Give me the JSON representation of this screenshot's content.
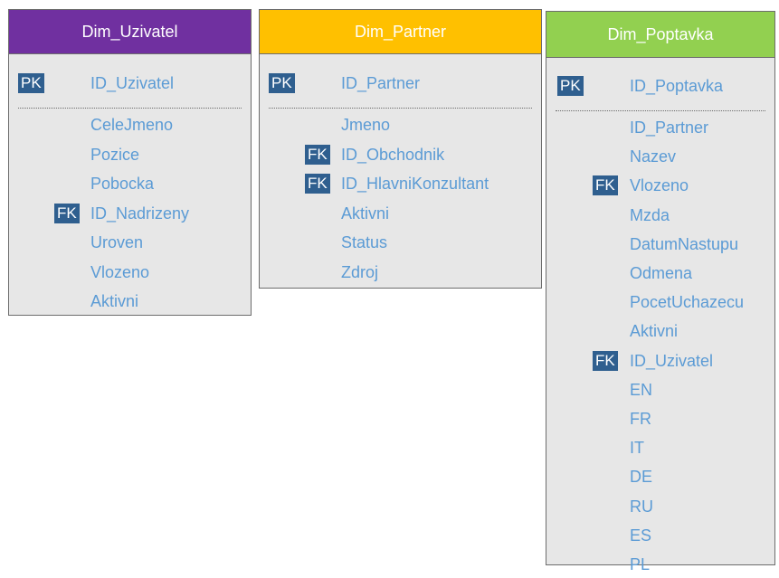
{
  "colors": {
    "uzivatel_header": "#7030a0",
    "partner_header": "#ffc000",
    "poptavka_header": "#92d050",
    "entity_body": "#e7e7e7",
    "field_text": "#5b9bd5",
    "key_badge": "#2f5f8f"
  },
  "tables": [
    {
      "name": "Dim_Uzivatel",
      "pk": {
        "badge": "PK",
        "field": "ID_Uzivatel"
      },
      "fields": [
        {
          "name": "CeleJmeno",
          "key": ""
        },
        {
          "name": "Pozice",
          "key": ""
        },
        {
          "name": "Pobocka",
          "key": ""
        },
        {
          "name": "ID_Nadrizeny",
          "key": "FK"
        },
        {
          "name": "Uroven",
          "key": ""
        },
        {
          "name": "Vlozeno",
          "key": ""
        },
        {
          "name": "Aktivni",
          "key": ""
        }
      ]
    },
    {
      "name": "Dim_Partner",
      "pk": {
        "badge": "PK",
        "field": "ID_Partner"
      },
      "fields": [
        {
          "name": "Jmeno",
          "key": ""
        },
        {
          "name": "ID_Obchodnik",
          "key": "FK"
        },
        {
          "name": "ID_HlavniKonzultant",
          "key": "FK"
        },
        {
          "name": "Aktivni",
          "key": ""
        },
        {
          "name": "Status",
          "key": ""
        },
        {
          "name": "Zdroj",
          "key": ""
        }
      ]
    },
    {
      "name": "Dim_Poptavka",
      "pk": {
        "badge": "PK",
        "field": "ID_Poptavka"
      },
      "fields": [
        {
          "name": "ID_Partner",
          "key": ""
        },
        {
          "name": "Nazev",
          "key": ""
        },
        {
          "name": "Vlozeno",
          "key": "FK"
        },
        {
          "name": "Mzda",
          "key": ""
        },
        {
          "name": "DatumNastupu",
          "key": ""
        },
        {
          "name": "Odmena",
          "key": ""
        },
        {
          "name": "PocetUchazecu",
          "key": ""
        },
        {
          "name": "Aktivni",
          "key": ""
        },
        {
          "name": "ID_Uzivatel",
          "key": "FK"
        },
        {
          "name": "EN",
          "key": ""
        },
        {
          "name": "FR",
          "key": ""
        },
        {
          "name": "IT",
          "key": ""
        },
        {
          "name": "DE",
          "key": ""
        },
        {
          "name": "RU",
          "key": ""
        },
        {
          "name": "ES",
          "key": ""
        },
        {
          "name": "PL",
          "key": ""
        }
      ]
    }
  ]
}
